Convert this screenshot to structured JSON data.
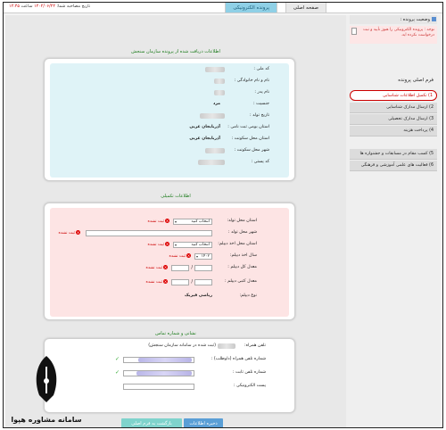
{
  "topbar": {
    "tab_home": "صفحه اصلی",
    "tab_file": "پرونده الکترونیکی",
    "interview_label": "تاریخ مصاحبه شما:",
    "interview_date": "۱۴۰۲/۰۶/۲۴",
    "interview_time_label": "ساعت",
    "interview_time": "۱۲:۴۵"
  },
  "received": {
    "title": "اطلاعات دریافت شده از پرونده سازمان سنجش",
    "fields": [
      {
        "label": "کد ملی :",
        "value": ""
      },
      {
        "label": "نام و نام خانوادگی :",
        "value": ""
      },
      {
        "label": "نام پدر :",
        "value": ""
      },
      {
        "label": "جنسیت :",
        "value": "مرد"
      },
      {
        "label": "تاریخ تولد :",
        "value": ""
      },
      {
        "label": "استان بومی ثبت نامی :",
        "value": "آذربایجان غربی"
      },
      {
        "label": "استان محل سکونت :",
        "value": "آذربایجان غربی"
      },
      {
        "label": "شهر محل سکونت :",
        "value": ""
      },
      {
        "label": "کد پستی :",
        "value": ""
      }
    ]
  },
  "extra": {
    "title": "اطلاعات تکمیلی",
    "birth_province_label": "استان محل تولد:",
    "birth_province_value": "انتخاب کنید",
    "birth_city_label": "شهر محل تولد :",
    "diploma_province_label": "استان محل اخذ دیپلم:",
    "diploma_province_value": "انتخاب کنید",
    "diploma_year_label": "سال اخذ دیپلم:",
    "diploma_year_value": "۱۴۰۲",
    "diploma_total_label": "معدل کل دیپلم :",
    "diploma_written_label": "معدل کتبی دیپلم :",
    "diploma_type_label": "نوع دیپلم:",
    "diploma_type_value": "ریاضی فیزیک",
    "required_text": "ثبت نشده"
  },
  "contact": {
    "title": "نشانی و شماره تماس",
    "mobile_label": "تلفن همراه:",
    "mobile_note": "(ثبت شده در سامانه سازمان سنجش)",
    "mobile2_label": "شماره تلفن همراه (داوطلب) :",
    "phone_label": "شماره تلفن ثابت :",
    "email_label": "پست الکترونیکی :"
  },
  "buttons": {
    "save": "ذخیره اطلاعات",
    "back": "بازگشت به فرم اصلی پرونده"
  },
  "sidebar": {
    "status_title": "وضعیت پرونده :",
    "status_message": "توجه : پرونده الکترونیکی را هنوز تأیید و ثبت درخواست نکرده اید.",
    "menu_title": "فرم اصلی پرونده",
    "items": [
      {
        "label": "1) تکمیل اطلاعات شناسایی"
      },
      {
        "label": "2) ارسال مدارک شناسایی"
      },
      {
        "label": "3) ارسال مدارک تحصیلی"
      },
      {
        "label": "4) پرداخت هزینه"
      },
      {
        "label": "5) کسب مقام در مسابقات و جشنواره ها"
      },
      {
        "label": "6) فعالیت های علمی آموزشی و فرهنگی"
      }
    ]
  },
  "logo": {
    "text": "سامانه مشاوره هپوا"
  }
}
